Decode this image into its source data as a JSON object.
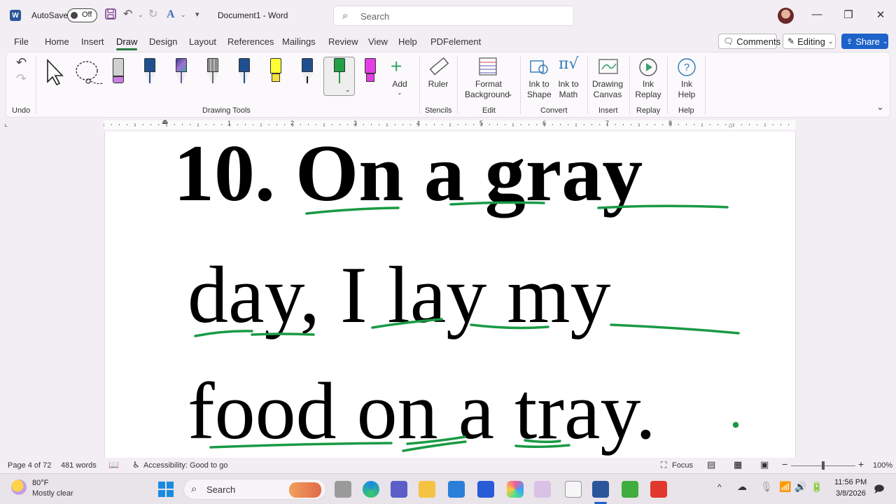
{
  "titlebar": {
    "autosave_label": "AutoSave",
    "autosave_state": "Off",
    "doc_title": "Document1  -  Word",
    "search_placeholder": "Search"
  },
  "menu": {
    "tabs": [
      "File",
      "Home",
      "Insert",
      "Draw",
      "Design",
      "Layout",
      "References",
      "Mailings",
      "Review",
      "View",
      "Help",
      "PDFelement"
    ],
    "active_tab": "Draw",
    "comments_label": "Comments",
    "editing_label": "Editing",
    "share_label": "Share"
  },
  "ribbon": {
    "undo_group": "Undo",
    "drawing_tools_group": "Drawing Tools",
    "add_label": "Add",
    "ruler_label": "Ruler",
    "stencils_group": "Stencils",
    "format_bg_line1": "Format",
    "format_bg_line2": "Background",
    "edit_group": "Edit",
    "ink_to_shape_1": "Ink to",
    "ink_to_shape_2": "Shape",
    "ink_to_math_1": "Ink to",
    "ink_to_math_2": "Math",
    "convert_group": "Convert",
    "drawing_canvas_1": "Drawing",
    "drawing_canvas_2": "Canvas",
    "insert_group": "Insert",
    "ink_replay_1": "Ink",
    "ink_replay_2": "Replay",
    "replay_group": "Replay",
    "ink_help_1": "Ink",
    "ink_help_2": "Help",
    "help_group": "Help",
    "pen_colors": [
      "#c9c9c9",
      "#1f4f8f",
      "#7b4fa5",
      "#888888",
      "#1f4f8f",
      "#ffff33",
      "#1f4f8f",
      "#22a045",
      "#e63ee6"
    ],
    "selected_pen": "#22a045"
  },
  "ruler": {
    "numbers": [
      "1",
      "2",
      "3",
      "4",
      "5",
      "6",
      "7",
      "8"
    ]
  },
  "document": {
    "line1": "10. On  a  gray",
    "line2": "day,  I  lay  my",
    "line3": "food  on  a  tray.",
    "ink_color": "#1a9a44"
  },
  "status": {
    "page": "Page 4 of 72",
    "words": "481 words",
    "accessibility": "Accessibility: Good to go",
    "focus": "Focus",
    "zoom": "100%"
  },
  "taskbar": {
    "temperature": "80°F",
    "weather": "Mostly clear",
    "search": "Search",
    "time": "11:56 PM",
    "date": "3/8/2026"
  }
}
